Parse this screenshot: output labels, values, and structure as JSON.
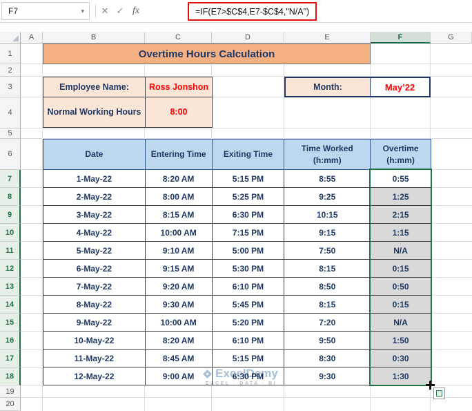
{
  "formula_bar": {
    "name_box": "F7",
    "dropdown_icon": "▾",
    "cancel": "✕",
    "enter": "✓",
    "fx": "fx",
    "formula": "=IF(E7>$C$4,E7-$C$4,\"N/A\")"
  },
  "grid": {
    "cols": [
      "A",
      "B",
      "C",
      "D",
      "E",
      "F",
      "G"
    ],
    "rows": [
      "1",
      "2",
      "3",
      "4",
      "5",
      "6",
      "7",
      "8",
      "9",
      "10",
      "11",
      "12",
      "13",
      "14",
      "15",
      "16",
      "17",
      "18",
      "19",
      "20"
    ]
  },
  "title": "Overtime Hours Calculation",
  "info": {
    "employee_label": "Employee Name:",
    "employee_value": "Ross Jonshon",
    "hours_label": "Normal Working Hours",
    "hours_value": "8:00",
    "month_label": "Month:",
    "month_value": "May’22"
  },
  "table": {
    "headers": {
      "date": "Date",
      "entering": "Entering Time",
      "exiting": "Exiting Time",
      "worked_1": "Time Worked",
      "worked_2": "(h:mm)",
      "overtime_1": "Overtime",
      "overtime_2": "(h:mm)"
    },
    "rows": [
      {
        "date": "1-May-22",
        "in": "8:20 AM",
        "out": "5:15 PM",
        "worked": "8:55",
        "ot": "0:55"
      },
      {
        "date": "2-May-22",
        "in": "8:00 AM",
        "out": "5:25 PM",
        "worked": "9:25",
        "ot": "1:25"
      },
      {
        "date": "3-May-22",
        "in": "8:15 AM",
        "out": "6:30 PM",
        "worked": "10:15",
        "ot": "2:15"
      },
      {
        "date": "4-May-22",
        "in": "10:00 AM",
        "out": "7:15 PM",
        "worked": "9:15",
        "ot": "1:15"
      },
      {
        "date": "5-May-22",
        "in": "9:10 AM",
        "out": "5:00 PM",
        "worked": "7:50",
        "ot": "N/A"
      },
      {
        "date": "6-May-22",
        "in": "9:15 AM",
        "out": "5:30 PM",
        "worked": "8:15",
        "ot": "0:15"
      },
      {
        "date": "7-May-22",
        "in": "9:20 AM",
        "out": "6:10 PM",
        "worked": "8:50",
        "ot": "0:50"
      },
      {
        "date": "8-May-22",
        "in": "9:30 AM",
        "out": "5:45 PM",
        "worked": "8:15",
        "ot": "0:15"
      },
      {
        "date": "9-May-22",
        "in": "10:00 AM",
        "out": "5:20 PM",
        "worked": "7:20",
        "ot": "N/A"
      },
      {
        "date": "10-May-22",
        "in": "8:20 AM",
        "out": "6:10 PM",
        "worked": "9:50",
        "ot": "1:50"
      },
      {
        "date": "11-May-22",
        "in": "8:45 AM",
        "out": "5:15 PM",
        "worked": "8:30",
        "ot": "0:30"
      },
      {
        "date": "12-May-22",
        "in": "9:00 AM",
        "out": "6:30 PM",
        "worked": "9:30",
        "ot": "1:30"
      }
    ]
  },
  "watermark": {
    "brand": "ExcelDemy",
    "tagline": "EXCEL · DATA · BI"
  },
  "colors": {
    "banner": "#f4b083",
    "peach": "#fbe5d6",
    "header_blue": "#bdd7ee",
    "navy": "#1f3864",
    "red": "#ff0000",
    "selection_green": "#1e7145",
    "selected_fill": "#d9d9d9",
    "annotation_red": "#e01010"
  }
}
